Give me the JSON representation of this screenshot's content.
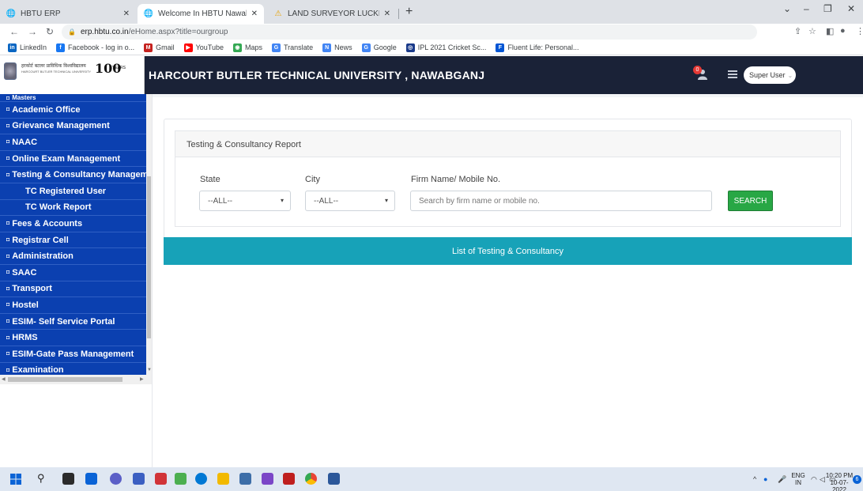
{
  "browser": {
    "tabs": [
      {
        "title": "HBTU ERP",
        "active": false
      },
      {
        "title": "Welcome In HBTU Nawabganj C",
        "active": true
      },
      {
        "title": "LAND SURVEYOR LUCKNOW | IC",
        "active": false
      }
    ],
    "url_host": "erp.hbtu.co.in",
    "url_path": "/eHome.aspx?title=ourgroup",
    "bookmarks": [
      {
        "label": "LinkedIn",
        "icon": "linkedin-icon",
        "color": "#0a66c2",
        "glyph": "in"
      },
      {
        "label": "Facebook - log in o...",
        "icon": "facebook-icon",
        "color": "#1877f2",
        "glyph": "f"
      },
      {
        "label": "Gmail",
        "icon": "gmail-icon",
        "color": "#c5221f",
        "glyph": "M"
      },
      {
        "label": "YouTube",
        "icon": "youtube-icon",
        "color": "#ff0000",
        "glyph": "▶"
      },
      {
        "label": "Maps",
        "icon": "maps-icon",
        "color": "#34a853",
        "glyph": "◉"
      },
      {
        "label": "Translate",
        "icon": "translate-icon",
        "color": "#4285f4",
        "glyph": "G"
      },
      {
        "label": "News",
        "icon": "news-icon",
        "color": "#4285f4",
        "glyph": "N"
      },
      {
        "label": "Google",
        "icon": "google-icon",
        "color": "#4285f4",
        "glyph": "G"
      },
      {
        "label": "IPL 2021 Cricket Sc...",
        "icon": "ipl-icon",
        "color": "#1a3a8a",
        "glyph": "◎"
      },
      {
        "label": "Fluent Life: Personal...",
        "icon": "fluent-icon",
        "color": "#0055d4",
        "glyph": "F"
      }
    ]
  },
  "header": {
    "logo_hindi": "हरकोर्ट बटलर प्राविधिक विश्वविद्यालय",
    "logo_english": "HARCOURT BUTLER TECHNICAL UNIVERSITY",
    "logo_number": "100",
    "logo_years": "YEARS",
    "title": "HARCOURT BUTLER TECHNICAL UNIVERSITY , NAWABGANJ",
    "notification_count": "0",
    "user_label": "Super User"
  },
  "sidebar": {
    "items": [
      {
        "label": "Masters",
        "sub": false
      },
      {
        "label": "Academic Office",
        "sub": false
      },
      {
        "label": "Grievance Management",
        "sub": false
      },
      {
        "label": "NAAC",
        "sub": false
      },
      {
        "label": "Online Exam Management",
        "sub": false
      },
      {
        "label": "Testing & Consultancy Management",
        "sub": false
      },
      {
        "label": "TC Registered User",
        "sub": true
      },
      {
        "label": "TC Work Report",
        "sub": true
      },
      {
        "label": "Fees & Accounts",
        "sub": false
      },
      {
        "label": "Registrar Cell",
        "sub": false
      },
      {
        "label": "Administration",
        "sub": false
      },
      {
        "label": "SAAC",
        "sub": false
      },
      {
        "label": "Transport",
        "sub": false
      },
      {
        "label": "Hostel",
        "sub": false
      },
      {
        "label": "ESIM- Self Service Portal",
        "sub": false
      },
      {
        "label": "HRMS",
        "sub": false
      },
      {
        "label": "ESIM-Gate Pass Management",
        "sub": false
      },
      {
        "label": "Examination",
        "sub": false
      }
    ]
  },
  "report": {
    "card_title": "Testing & Consultancy Report",
    "state_label": "State",
    "state_value": "--ALL--",
    "city_label": "City",
    "city_value": "--ALL--",
    "firm_label": "Firm Name/ Mobile No.",
    "firm_placeholder": "Search by firm name or mobile no.",
    "search_button": "SEARCH",
    "list_title": "List of Testing & Consultancy"
  },
  "taskbar": {
    "lang_top": "ENG",
    "lang_bottom": "IN",
    "time": "10:20 PM",
    "date": "10-07-2022",
    "notification_count": "6"
  },
  "colors": {
    "header_bg": "#1a2237",
    "sidebar_bg": "#0b40b0",
    "list_bar": "#17a2b8",
    "search_btn": "#28a745"
  }
}
